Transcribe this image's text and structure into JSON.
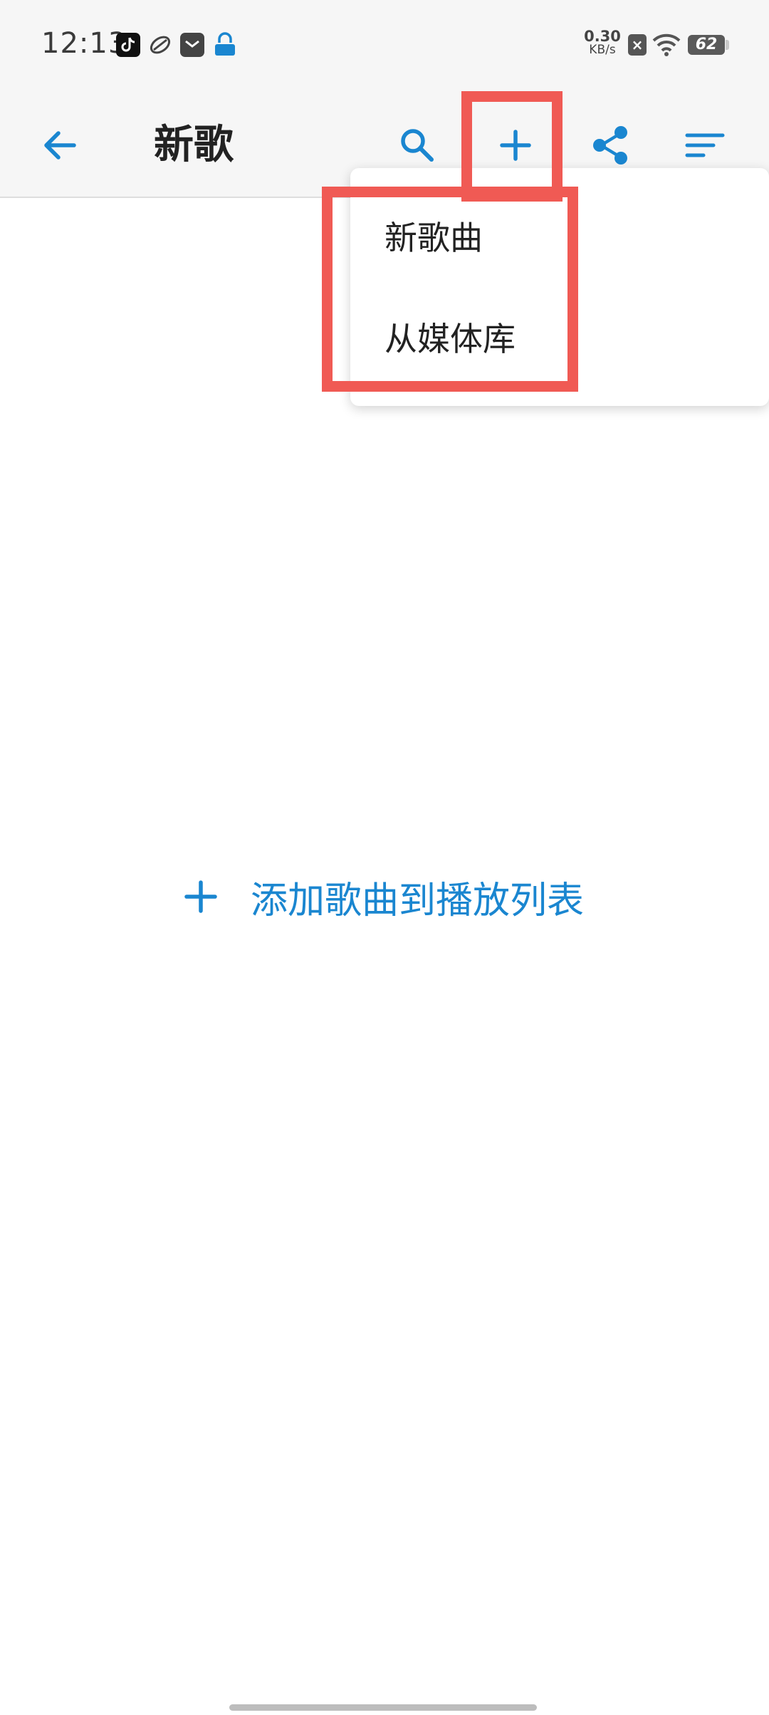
{
  "status_bar": {
    "time": "12:13",
    "net_speed_value": "0.30",
    "net_speed_unit": "KB/s",
    "battery": "62",
    "icons": [
      "tiktok-icon",
      "app-icon",
      "mail-icon",
      "vpn-icon",
      "x-icon",
      "wifi-icon",
      "battery-icon"
    ]
  },
  "toolbar": {
    "title": "新歌",
    "icons": [
      "back-arrow-icon",
      "search-icon",
      "plus-icon",
      "share-icon",
      "sort-icon"
    ]
  },
  "menu": {
    "items": [
      {
        "label": "新歌曲"
      },
      {
        "label": "从媒体库"
      }
    ]
  },
  "empty_state": {
    "action_label": "添加歌曲到播放列表"
  },
  "colors": {
    "accent": "#1a86d0",
    "highlight": "#f05a54",
    "toolbar_bg": "#f6f6f6"
  }
}
